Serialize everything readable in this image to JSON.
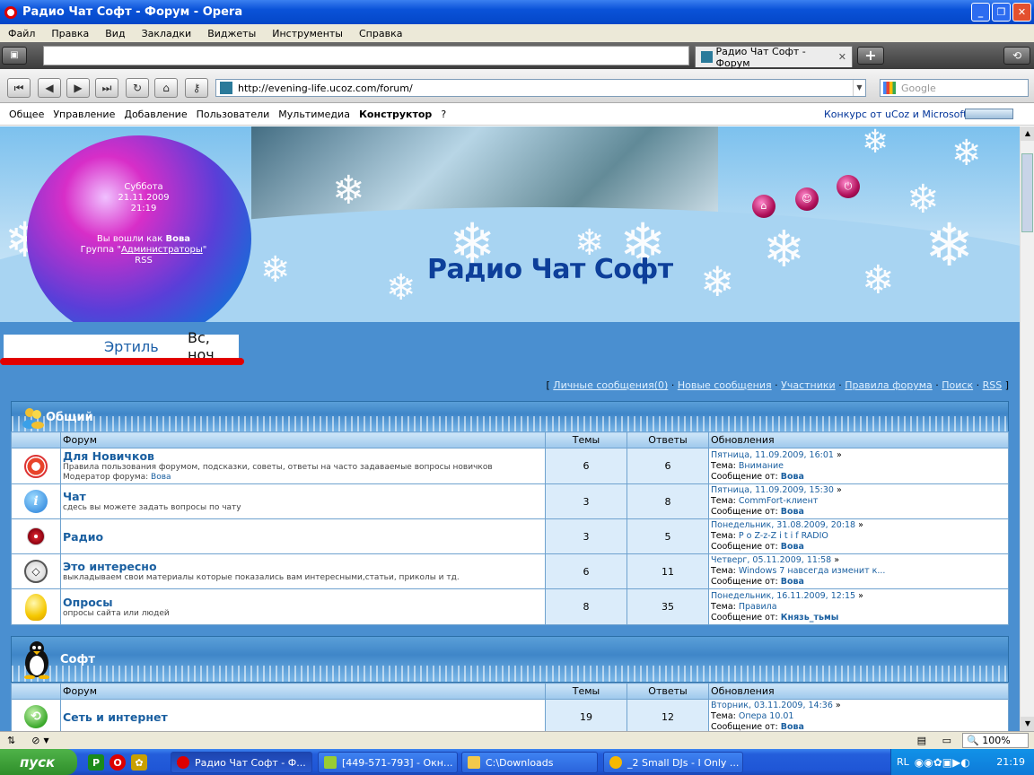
{
  "window": {
    "title": "Радио Чат Софт - Форум - Opera"
  },
  "menu": [
    "Файл",
    "Правка",
    "Вид",
    "Закладки",
    "Виджеты",
    "Инструменты",
    "Справка"
  ],
  "tabs": {
    "active_label": "Радио Чат Софт - Форум"
  },
  "address": {
    "url": "http://evening-life.ucoz.com/forum/",
    "search_placeholder": "Google"
  },
  "ucozbar": {
    "items": [
      "Общее",
      "Управление",
      "Добавление",
      "Пользователи",
      "Мультимедиа",
      "Конструктор",
      "?"
    ],
    "contest": "Конкурс от uCoz и Microsoft"
  },
  "header": {
    "day": "Суббота",
    "date": "21.11.2009",
    "time": "21:19",
    "login_prefix": "Вы вошли как",
    "user": "Вова",
    "group_prefix": "Группа \"",
    "group": "Администраторы",
    "group_suffix": "\"",
    "rss": "RSS",
    "site_title": "Радио Чат Софт"
  },
  "marquee": {
    "text1": "Эртиль",
    "text2": "Вс, ноч"
  },
  "forum_links": {
    "open": "[",
    "items": [
      "Личные сообщения(0)",
      "Новые сообщения",
      "Участники",
      "Правила форума",
      "Поиск",
      "RSS"
    ],
    "sep": "·",
    "close": "]"
  },
  "columns": {
    "forum": "Форум",
    "topics": "Темы",
    "replies": "Ответы",
    "updates": "Обновления"
  },
  "labels": {
    "topic": "Тема:",
    "message_from": "Сообщение от:",
    "moderator": "Модератор форума:"
  },
  "categories": [
    {
      "name": "Общий",
      "forums": [
        {
          "name": "Для Новичков",
          "desc": "Правила пользования форумом, подсказки, советы, ответы на часто задаваемые вопросы новичков",
          "moderator": "Вова",
          "topics": "6",
          "replies": "6",
          "date": "Пятница, 11.09.2009, 16:01",
          "topic": "Внимание",
          "author": "Вова"
        },
        {
          "name": "Чат",
          "desc": "сдесь вы можете задать вопросы по чату",
          "topics": "3",
          "replies": "8",
          "date": "Пятница, 11.09.2009, 15:30",
          "topic": "CommFort-клиент",
          "author": "Вова"
        },
        {
          "name": "Радио",
          "desc": "",
          "topics": "3",
          "replies": "5",
          "date": "Понедельник, 31.08.2009, 20:18",
          "topic": "P o Z-z-Z i t i f RADIO",
          "author": "Вова"
        },
        {
          "name": "Это интересно",
          "desc": "выкладываем свои материалы которые показались вам интересными,статьи, приколы и тд.",
          "topics": "6",
          "replies": "11",
          "date": "Четверг, 05.11.2009, 11:58",
          "topic": "Windows 7 навсегда изменит к...",
          "author": "Вова"
        },
        {
          "name": "Опросы",
          "desc": "опросы сайта или людей",
          "topics": "8",
          "replies": "35",
          "date": "Понедельник, 16.11.2009, 12:15",
          "topic": "Правила",
          "author": "Князь_тьмы"
        }
      ]
    },
    {
      "name": "Софт",
      "forums": [
        {
          "name": "Сеть и интернет",
          "desc": "",
          "topics": "19",
          "replies": "12",
          "date": "Вторник, 03.11.2009, 14:36",
          "topic": "Опера 10.01",
          "author": "Вова"
        }
      ]
    }
  ],
  "statusbar": {
    "zoom": "100%"
  },
  "taskbar": {
    "start": "пуск",
    "tasks": [
      "Радио Чат Софт - Ф...",
      "[449-571-793] - Окн...",
      "C:\\Downloads",
      "_2 Small DJs - I Only ..."
    ],
    "lang": "RL",
    "clock": "21:19"
  }
}
